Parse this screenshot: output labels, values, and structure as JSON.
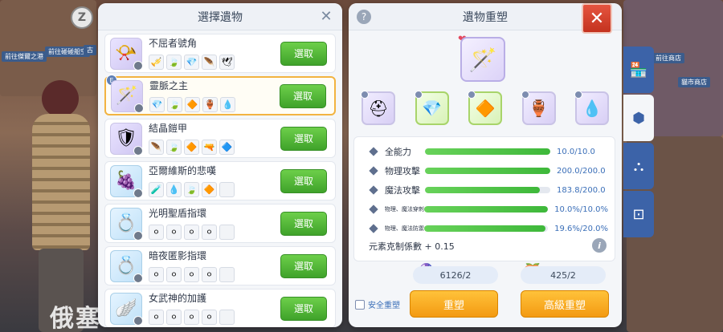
{
  "background": {
    "signs": [
      "前往傑爾之港",
      "前往碰碰船空",
      "古",
      "前往商店",
      "貓市商店"
    ],
    "bottom_text": "俄塞"
  },
  "left_panel": {
    "title": "選擇遺物",
    "items": [
      {
        "name": "不屈者號角",
        "select_label": "選取",
        "icon": "📯",
        "materials": [
          "🎺",
          "🍃",
          "💎",
          "🪶",
          "🕊"
        ]
      },
      {
        "name": "靈脈之主",
        "select_label": "選取",
        "icon": "🪄",
        "badge": "E",
        "materials": [
          "💎",
          "🍃",
          "🔶",
          "🏺",
          "💧"
        ]
      },
      {
        "name": "結晶鎧甲",
        "select_label": "選取",
        "icon": "🛡",
        "materials": [
          "🪶",
          "🍃",
          "🔶",
          "🔫",
          "🔷"
        ]
      },
      {
        "name": "亞爾維斯的悲嘆",
        "select_label": "選取",
        "icon": "🍇",
        "materials": [
          "🧪",
          "💧",
          "🍃",
          "🔶"
        ]
      },
      {
        "name": "光明聖盾指環",
        "select_label": "選取",
        "icon": "💍",
        "materials": [
          "⚪",
          "⚪",
          "⚪",
          "⚪"
        ]
      },
      {
        "name": "暗夜匿影指環",
        "select_label": "選取",
        "icon": "💍",
        "materials": [
          "⚪",
          "⚪",
          "⚪",
          "⚪"
        ]
      },
      {
        "name": "女武神的加護",
        "select_label": "選取",
        "icon": "🪽",
        "materials": [
          "⚪",
          "⚪",
          "⚪",
          "⚪"
        ]
      }
    ]
  },
  "right_panel": {
    "title": "遺物重塑",
    "main_relic_icon": "🪄",
    "slots": [
      "⛑",
      "💎",
      "🔶",
      "🏺",
      "💧"
    ],
    "stats": [
      {
        "label": "全能力",
        "value": "10.0/10.0",
        "fill": 1.0
      },
      {
        "label": "物理攻擊",
        "value": "200.0/200.0",
        "fill": 1.0
      },
      {
        "label": "魔法攻擊",
        "value": "183.8/200.0",
        "fill": 0.919
      },
      {
        "label": "物理、魔法穿刺",
        "value": "10.0%/10.0%",
        "fill": 1.0
      },
      {
        "label": "物理、魔法防禦",
        "value": "19.6%/20.0%",
        "fill": 0.98
      }
    ],
    "element_text": "元素克制係數 + 0.15",
    "costs": [
      "6126/2",
      "425/2"
    ],
    "safe_label": "安全重塑",
    "reforge_label": "重塑",
    "advanced_label": "高級重塑"
  },
  "colors": {
    "accent_green": "#3eb83a",
    "accent_orange": "#f39a12",
    "tab_blue": "#3c63a8"
  }
}
